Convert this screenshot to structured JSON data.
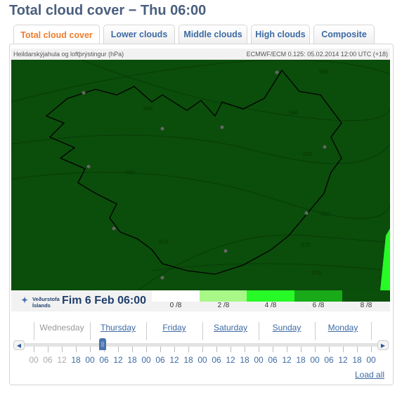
{
  "title": "Total cloud cover − Thu 06:00",
  "tabs": [
    {
      "label": "Total cloud cover",
      "active": true
    },
    {
      "label": "Lower clouds"
    },
    {
      "label": "Middle clouds"
    },
    {
      "label": "High clouds"
    },
    {
      "label": "Composite"
    }
  ],
  "map": {
    "subtitle": "Heildarskýjahula og loftþrýstingur (hPa)",
    "source": "ECMWF/ECM 0.125: 05.02.2014 12:00 UTC (+18)",
    "isobars": [
      "988",
      "986",
      "984",
      "984",
      "982",
      "980",
      "978",
      "976",
      "976"
    ],
    "background_color": "#0b4d0b"
  },
  "legend": {
    "logo_line1": "Veðurstofa",
    "logo_line2": "Íslands",
    "date": "Fim 6 Feb 06:00",
    "items": [
      {
        "label": "0 /8",
        "color": "#ffffff"
      },
      {
        "label": "2 /8",
        "color": "#a8f888"
      },
      {
        "label": "4 /8",
        "color": "#28fa28"
      },
      {
        "label": "6 /8",
        "color": "#18aa18"
      },
      {
        "label": "8 /8",
        "color": "#0a4f0a"
      }
    ]
  },
  "timeline": {
    "days": [
      "Wednesday",
      "Thursday",
      "Friday",
      "Saturday",
      "Sunday",
      "Monday"
    ],
    "hours": [
      "00",
      "06",
      "12",
      "18",
      "00",
      "06",
      "12",
      "18",
      "00",
      "06",
      "12",
      "18",
      "00",
      "06",
      "12",
      "18",
      "00",
      "06",
      "12",
      "18",
      "00",
      "06",
      "12",
      "18",
      "00"
    ],
    "selected": "Thursday 06",
    "load_all": "Load all"
  }
}
